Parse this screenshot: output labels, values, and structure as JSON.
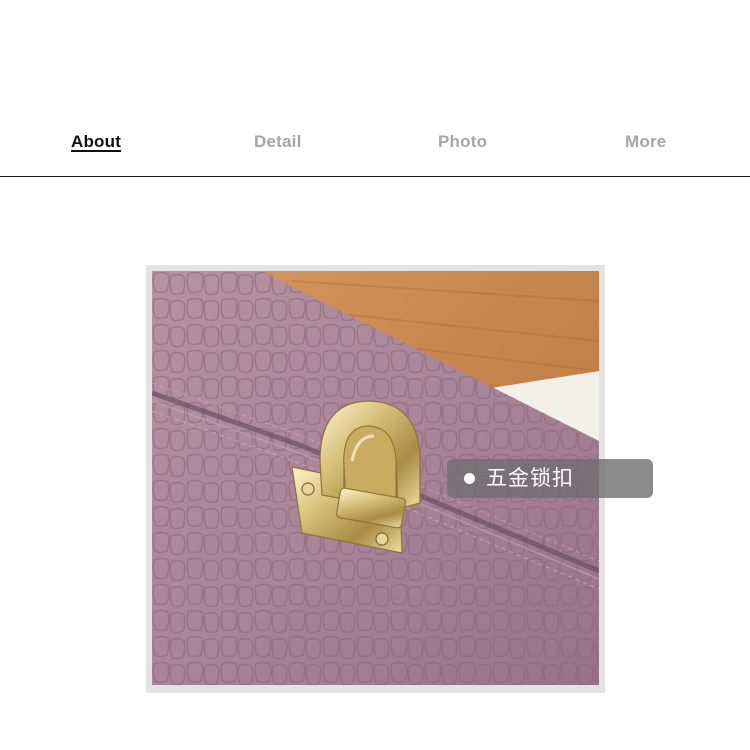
{
  "tabs": [
    {
      "label": "About",
      "active": true
    },
    {
      "label": "Detail",
      "active": false
    },
    {
      "label": "Photo",
      "active": false
    },
    {
      "label": "More",
      "active": false
    }
  ],
  "photo": {
    "subject": "pink-croc-handbag-with-gold-lock",
    "colors": {
      "leather": "#a9849a",
      "leather_dark": "#7d5d70",
      "wood": "#c88a52",
      "gold": "#d9c17a"
    }
  },
  "annotation": {
    "label": "五金锁扣"
  }
}
